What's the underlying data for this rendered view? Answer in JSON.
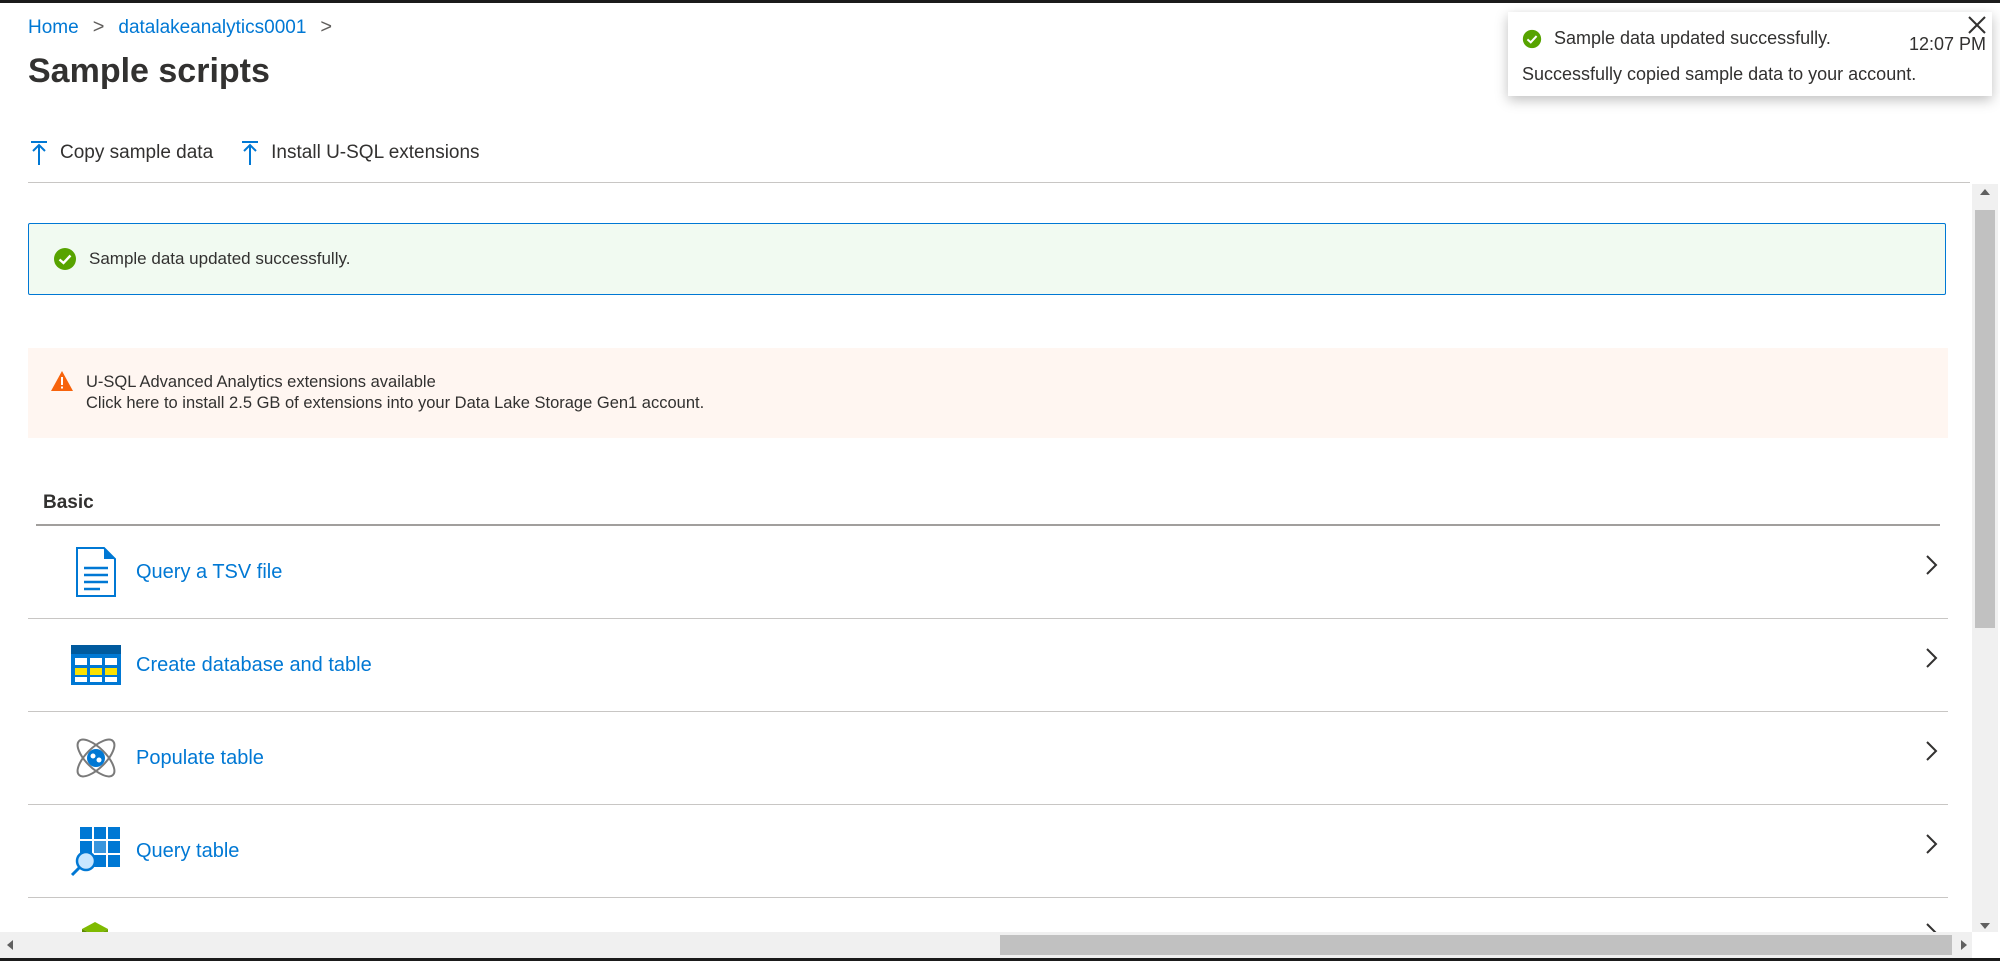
{
  "breadcrumb": {
    "home": "Home",
    "account": "datalakeanalytics0001",
    "sep": ">"
  },
  "page": {
    "title": "Sample scripts"
  },
  "commands": {
    "copy_sample": "Copy sample data",
    "install_extensions": "Install U-SQL extensions"
  },
  "success_banner": {
    "text": "Sample data updated successfully."
  },
  "warning_banner": {
    "line1": "U-SQL Advanced Analytics extensions available",
    "line2": "Click here to install 2.5 GB of extensions into your Data Lake Storage Gen1 account."
  },
  "section": {
    "heading": "Basic"
  },
  "scripts": [
    {
      "label": "Query a TSV file",
      "icon": "document-icon"
    },
    {
      "label": "Create database and table",
      "icon": "table-icon"
    },
    {
      "label": "Populate table",
      "icon": "atom-icon"
    },
    {
      "label": "Query table",
      "icon": "grid-search-icon"
    }
  ],
  "toast": {
    "title": "Sample data updated successfully.",
    "time": "12:07 PM",
    "message": "Successfully copied sample data to your account."
  },
  "colors": {
    "accent": "#0078d4",
    "success": "#57a300",
    "warning": "#f7630c"
  }
}
